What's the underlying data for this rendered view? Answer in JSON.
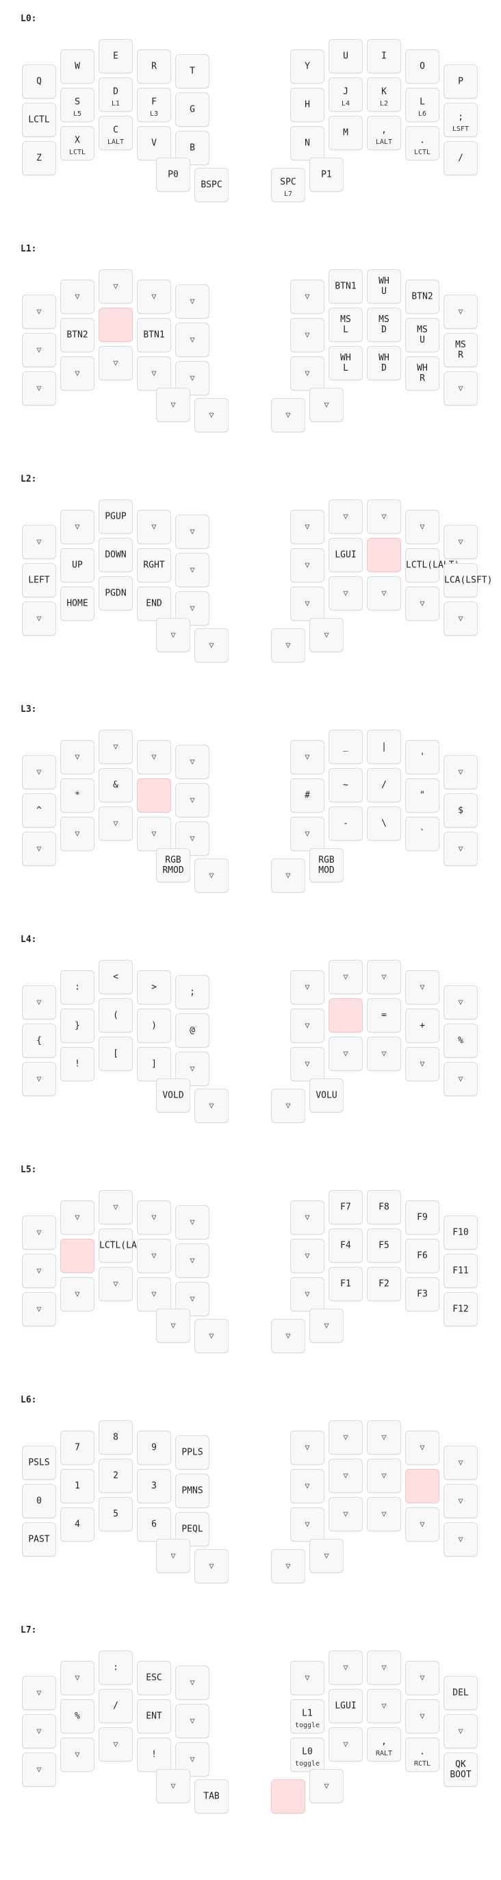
{
  "layers": [
    {
      "label": "L0:",
      "keys": [
        {
          "tap": "Q",
          "hold": ""
        },
        {
          "tap": "W",
          "hold": ""
        },
        {
          "tap": "E",
          "hold": ""
        },
        {
          "tap": "R",
          "hold": ""
        },
        {
          "tap": "T",
          "hold": ""
        },
        {
          "tap": "LCTL",
          "hold": ""
        },
        {
          "tap": "S",
          "hold": "L5"
        },
        {
          "tap": "D",
          "hold": "L1"
        },
        {
          "tap": "F",
          "hold": "L3"
        },
        {
          "tap": "G",
          "hold": ""
        },
        {
          "tap": "Z",
          "hold": ""
        },
        {
          "tap": "X",
          "hold": "LCTL"
        },
        {
          "tap": "C",
          "hold": "LALT"
        },
        {
          "tap": "V",
          "hold": ""
        },
        {
          "tap": "B",
          "hold": ""
        },
        {
          "tap": "Y",
          "hold": ""
        },
        {
          "tap": "U",
          "hold": ""
        },
        {
          "tap": "I",
          "hold": ""
        },
        {
          "tap": "O",
          "hold": ""
        },
        {
          "tap": "P",
          "hold": ""
        },
        {
          "tap": "H",
          "hold": ""
        },
        {
          "tap": "J",
          "hold": "L4"
        },
        {
          "tap": "K",
          "hold": "L2"
        },
        {
          "tap": "L",
          "hold": "L6"
        },
        {
          "tap": ";",
          "hold": "LSFT"
        },
        {
          "tap": "N",
          "hold": ""
        },
        {
          "tap": "M",
          "hold": ""
        },
        {
          "tap": ",",
          "hold": "LALT"
        },
        {
          "tap": ".",
          "hold": "LCTL"
        },
        {
          "tap": "/",
          "hold": ""
        },
        {
          "tap": "P0",
          "hold": ""
        },
        {
          "tap": "BSPC",
          "hold": ""
        },
        {
          "tap": "SPC",
          "hold": "L7"
        },
        {
          "tap": "P1",
          "hold": ""
        }
      ]
    },
    {
      "label": "L1:",
      "keys": [
        {
          "tap": "▽",
          "hold": ""
        },
        {
          "tap": "▽",
          "hold": ""
        },
        {
          "tap": "▽",
          "hold": ""
        },
        {
          "tap": "▽",
          "hold": ""
        },
        {
          "tap": "▽",
          "hold": ""
        },
        {
          "tap": "▽",
          "hold": ""
        },
        {
          "tap": "BTN2",
          "hold": ""
        },
        {
          "tap": "",
          "hold": "",
          "held": true
        },
        {
          "tap": "BTN1",
          "hold": ""
        },
        {
          "tap": "▽",
          "hold": ""
        },
        {
          "tap": "▽",
          "hold": ""
        },
        {
          "tap": "▽",
          "hold": ""
        },
        {
          "tap": "▽",
          "hold": ""
        },
        {
          "tap": "▽",
          "hold": ""
        },
        {
          "tap": "▽",
          "hold": ""
        },
        {
          "tap": "▽",
          "hold": ""
        },
        {
          "tap": "BTN1",
          "hold": ""
        },
        {
          "tap": "WH\nU",
          "hold": ""
        },
        {
          "tap": "BTN2",
          "hold": ""
        },
        {
          "tap": "▽",
          "hold": ""
        },
        {
          "tap": "▽",
          "hold": ""
        },
        {
          "tap": "MS\nL",
          "hold": ""
        },
        {
          "tap": "MS\nD",
          "hold": ""
        },
        {
          "tap": "MS\nU",
          "hold": ""
        },
        {
          "tap": "MS\nR",
          "hold": ""
        },
        {
          "tap": "▽",
          "hold": ""
        },
        {
          "tap": "WH\nL",
          "hold": ""
        },
        {
          "tap": "WH\nD",
          "hold": ""
        },
        {
          "tap": "WH\nR",
          "hold": ""
        },
        {
          "tap": "▽",
          "hold": ""
        },
        {
          "tap": "▽",
          "hold": ""
        },
        {
          "tap": "▽",
          "hold": ""
        },
        {
          "tap": "▽",
          "hold": ""
        },
        {
          "tap": "▽",
          "hold": ""
        }
      ]
    },
    {
      "label": "L2:",
      "keys": [
        {
          "tap": "▽",
          "hold": ""
        },
        {
          "tap": "▽",
          "hold": ""
        },
        {
          "tap": "PGUP",
          "hold": ""
        },
        {
          "tap": "▽",
          "hold": ""
        },
        {
          "tap": "▽",
          "hold": ""
        },
        {
          "tap": "LEFT",
          "hold": ""
        },
        {
          "tap": "UP",
          "hold": ""
        },
        {
          "tap": "DOWN",
          "hold": ""
        },
        {
          "tap": "RGHT",
          "hold": ""
        },
        {
          "tap": "▽",
          "hold": ""
        },
        {
          "tap": "▽",
          "hold": ""
        },
        {
          "tap": "HOME",
          "hold": ""
        },
        {
          "tap": "PGDN",
          "hold": ""
        },
        {
          "tap": "END",
          "hold": ""
        },
        {
          "tap": "▽",
          "hold": ""
        },
        {
          "tap": "▽",
          "hold": ""
        },
        {
          "tap": "▽",
          "hold": ""
        },
        {
          "tap": "▽",
          "hold": ""
        },
        {
          "tap": "▽",
          "hold": ""
        },
        {
          "tap": "▽",
          "hold": ""
        },
        {
          "tap": "▽",
          "hold": ""
        },
        {
          "tap": "LGUI",
          "hold": ""
        },
        {
          "tap": "",
          "hold": "",
          "held": true
        },
        {
          "tap": "LCTL(LALT)",
          "hold": ""
        },
        {
          "tap": "LCA(LSFT)",
          "hold": ""
        },
        {
          "tap": "▽",
          "hold": ""
        },
        {
          "tap": "▽",
          "hold": ""
        },
        {
          "tap": "▽",
          "hold": ""
        },
        {
          "tap": "▽",
          "hold": ""
        },
        {
          "tap": "▽",
          "hold": ""
        },
        {
          "tap": "▽",
          "hold": ""
        },
        {
          "tap": "▽",
          "hold": ""
        },
        {
          "tap": "▽",
          "hold": ""
        },
        {
          "tap": "▽",
          "hold": ""
        }
      ]
    },
    {
      "label": "L3:",
      "keys": [
        {
          "tap": "▽",
          "hold": ""
        },
        {
          "tap": "▽",
          "hold": ""
        },
        {
          "tap": "▽",
          "hold": ""
        },
        {
          "tap": "▽",
          "hold": ""
        },
        {
          "tap": "▽",
          "hold": ""
        },
        {
          "tap": "^",
          "hold": ""
        },
        {
          "tap": "*",
          "hold": ""
        },
        {
          "tap": "&",
          "hold": ""
        },
        {
          "tap": "",
          "hold": "",
          "held": true
        },
        {
          "tap": "▽",
          "hold": ""
        },
        {
          "tap": "▽",
          "hold": ""
        },
        {
          "tap": "▽",
          "hold": ""
        },
        {
          "tap": "▽",
          "hold": ""
        },
        {
          "tap": "▽",
          "hold": ""
        },
        {
          "tap": "▽",
          "hold": ""
        },
        {
          "tap": "▽",
          "hold": ""
        },
        {
          "tap": "_",
          "hold": ""
        },
        {
          "tap": "|",
          "hold": ""
        },
        {
          "tap": "'",
          "hold": ""
        },
        {
          "tap": "▽",
          "hold": ""
        },
        {
          "tap": "#",
          "hold": ""
        },
        {
          "tap": "~",
          "hold": ""
        },
        {
          "tap": "/",
          "hold": ""
        },
        {
          "tap": "\"",
          "hold": ""
        },
        {
          "tap": "$",
          "hold": ""
        },
        {
          "tap": "▽",
          "hold": ""
        },
        {
          "tap": "-",
          "hold": ""
        },
        {
          "tap": "\\",
          "hold": ""
        },
        {
          "tap": "`",
          "hold": ""
        },
        {
          "tap": "▽",
          "hold": ""
        },
        {
          "tap": "RGB\nRMOD",
          "hold": ""
        },
        {
          "tap": "▽",
          "hold": ""
        },
        {
          "tap": "▽",
          "hold": ""
        },
        {
          "tap": "RGB\nMOD",
          "hold": ""
        }
      ]
    },
    {
      "label": "L4:",
      "keys": [
        {
          "tap": "▽",
          "hold": ""
        },
        {
          "tap": ":",
          "hold": ""
        },
        {
          "tap": "<",
          "hold": ""
        },
        {
          "tap": ">",
          "hold": ""
        },
        {
          "tap": ";",
          "hold": ""
        },
        {
          "tap": "{",
          "hold": ""
        },
        {
          "tap": "}",
          "hold": ""
        },
        {
          "tap": "(",
          "hold": ""
        },
        {
          "tap": ")",
          "hold": ""
        },
        {
          "tap": "@",
          "hold": ""
        },
        {
          "tap": "▽",
          "hold": ""
        },
        {
          "tap": "!",
          "hold": ""
        },
        {
          "tap": "[",
          "hold": ""
        },
        {
          "tap": "]",
          "hold": ""
        },
        {
          "tap": "▽",
          "hold": ""
        },
        {
          "tap": "▽",
          "hold": ""
        },
        {
          "tap": "▽",
          "hold": ""
        },
        {
          "tap": "▽",
          "hold": ""
        },
        {
          "tap": "▽",
          "hold": ""
        },
        {
          "tap": "▽",
          "hold": ""
        },
        {
          "tap": "▽",
          "hold": ""
        },
        {
          "tap": "",
          "hold": "",
          "held": true
        },
        {
          "tap": "=",
          "hold": ""
        },
        {
          "tap": "+",
          "hold": ""
        },
        {
          "tap": "%",
          "hold": ""
        },
        {
          "tap": "▽",
          "hold": ""
        },
        {
          "tap": "▽",
          "hold": ""
        },
        {
          "tap": "▽",
          "hold": ""
        },
        {
          "tap": "▽",
          "hold": ""
        },
        {
          "tap": "▽",
          "hold": ""
        },
        {
          "tap": "VOLD",
          "hold": ""
        },
        {
          "tap": "▽",
          "hold": ""
        },
        {
          "tap": "▽",
          "hold": ""
        },
        {
          "tap": "VOLU",
          "hold": ""
        }
      ]
    },
    {
      "label": "L5:",
      "keys": [
        {
          "tap": "▽",
          "hold": ""
        },
        {
          "tap": "▽",
          "hold": ""
        },
        {
          "tap": "▽",
          "hold": ""
        },
        {
          "tap": "▽",
          "hold": ""
        },
        {
          "tap": "▽",
          "hold": ""
        },
        {
          "tap": "▽",
          "hold": ""
        },
        {
          "tap": "",
          "hold": "",
          "held": true
        },
        {
          "tap": "LCTL(LALT)",
          "hold": ""
        },
        {
          "tap": "▽",
          "hold": ""
        },
        {
          "tap": "▽",
          "hold": ""
        },
        {
          "tap": "▽",
          "hold": ""
        },
        {
          "tap": "▽",
          "hold": ""
        },
        {
          "tap": "▽",
          "hold": ""
        },
        {
          "tap": "▽",
          "hold": ""
        },
        {
          "tap": "▽",
          "hold": ""
        },
        {
          "tap": "▽",
          "hold": ""
        },
        {
          "tap": "F7",
          "hold": ""
        },
        {
          "tap": "F8",
          "hold": ""
        },
        {
          "tap": "F9",
          "hold": ""
        },
        {
          "tap": "F10",
          "hold": ""
        },
        {
          "tap": "▽",
          "hold": ""
        },
        {
          "tap": "F4",
          "hold": ""
        },
        {
          "tap": "F5",
          "hold": ""
        },
        {
          "tap": "F6",
          "hold": ""
        },
        {
          "tap": "F11",
          "hold": ""
        },
        {
          "tap": "▽",
          "hold": ""
        },
        {
          "tap": "F1",
          "hold": ""
        },
        {
          "tap": "F2",
          "hold": ""
        },
        {
          "tap": "F3",
          "hold": ""
        },
        {
          "tap": "F12",
          "hold": ""
        },
        {
          "tap": "▽",
          "hold": ""
        },
        {
          "tap": "▽",
          "hold": ""
        },
        {
          "tap": "▽",
          "hold": ""
        },
        {
          "tap": "▽",
          "hold": ""
        }
      ]
    },
    {
      "label": "L6:",
      "keys": [
        {
          "tap": "PSLS",
          "hold": ""
        },
        {
          "tap": "7",
          "hold": ""
        },
        {
          "tap": "8",
          "hold": ""
        },
        {
          "tap": "9",
          "hold": ""
        },
        {
          "tap": "PPLS",
          "hold": ""
        },
        {
          "tap": "0",
          "hold": ""
        },
        {
          "tap": "1",
          "hold": ""
        },
        {
          "tap": "2",
          "hold": ""
        },
        {
          "tap": "3",
          "hold": ""
        },
        {
          "tap": "PMNS",
          "hold": ""
        },
        {
          "tap": "PAST",
          "hold": ""
        },
        {
          "tap": "4",
          "hold": ""
        },
        {
          "tap": "5",
          "hold": ""
        },
        {
          "tap": "6",
          "hold": ""
        },
        {
          "tap": "PEQL",
          "hold": ""
        },
        {
          "tap": "▽",
          "hold": ""
        },
        {
          "tap": "▽",
          "hold": ""
        },
        {
          "tap": "▽",
          "hold": ""
        },
        {
          "tap": "▽",
          "hold": ""
        },
        {
          "tap": "▽",
          "hold": ""
        },
        {
          "tap": "▽",
          "hold": ""
        },
        {
          "tap": "▽",
          "hold": ""
        },
        {
          "tap": "▽",
          "hold": ""
        },
        {
          "tap": "",
          "hold": "",
          "held": true
        },
        {
          "tap": "▽",
          "hold": ""
        },
        {
          "tap": "▽",
          "hold": ""
        },
        {
          "tap": "▽",
          "hold": ""
        },
        {
          "tap": "▽",
          "hold": ""
        },
        {
          "tap": "▽",
          "hold": ""
        },
        {
          "tap": "▽",
          "hold": ""
        },
        {
          "tap": "▽",
          "hold": ""
        },
        {
          "tap": "▽",
          "hold": ""
        },
        {
          "tap": "▽",
          "hold": ""
        },
        {
          "tap": "▽",
          "hold": ""
        }
      ]
    },
    {
      "label": "L7:",
      "keys": [
        {
          "tap": "▽",
          "hold": ""
        },
        {
          "tap": "▽",
          "hold": ""
        },
        {
          "tap": ":",
          "hold": ""
        },
        {
          "tap": "ESC",
          "hold": ""
        },
        {
          "tap": "▽",
          "hold": ""
        },
        {
          "tap": "▽",
          "hold": ""
        },
        {
          "tap": "%",
          "hold": ""
        },
        {
          "tap": "/",
          "hold": ""
        },
        {
          "tap": "ENT",
          "hold": ""
        },
        {
          "tap": "▽",
          "hold": ""
        },
        {
          "tap": "▽",
          "hold": ""
        },
        {
          "tap": "▽",
          "hold": ""
        },
        {
          "tap": "▽",
          "hold": ""
        },
        {
          "tap": "!",
          "hold": ""
        },
        {
          "tap": "▽",
          "hold": ""
        },
        {
          "tap": "▽",
          "hold": ""
        },
        {
          "tap": "▽",
          "hold": ""
        },
        {
          "tap": "▽",
          "hold": ""
        },
        {
          "tap": "▽",
          "hold": ""
        },
        {
          "tap": "DEL",
          "hold": ""
        },
        {
          "tap": "L1",
          "hold": "toggle"
        },
        {
          "tap": "LGUI",
          "hold": ""
        },
        {
          "tap": "▽",
          "hold": ""
        },
        {
          "tap": "▽",
          "hold": ""
        },
        {
          "tap": "▽",
          "hold": ""
        },
        {
          "tap": "L0",
          "hold": "toggle"
        },
        {
          "tap": "▽",
          "hold": ""
        },
        {
          "tap": ",",
          "hold": "RALT"
        },
        {
          "tap": ".",
          "hold": "RCTL"
        },
        {
          "tap": "QK\nBOOT",
          "hold": ""
        },
        {
          "tap": "▽",
          "hold": ""
        },
        {
          "tap": "TAB",
          "hold": ""
        },
        {
          "tap": "",
          "hold": "",
          "held": true
        },
        {
          "tap": "▽",
          "hold": ""
        }
      ]
    }
  ]
}
